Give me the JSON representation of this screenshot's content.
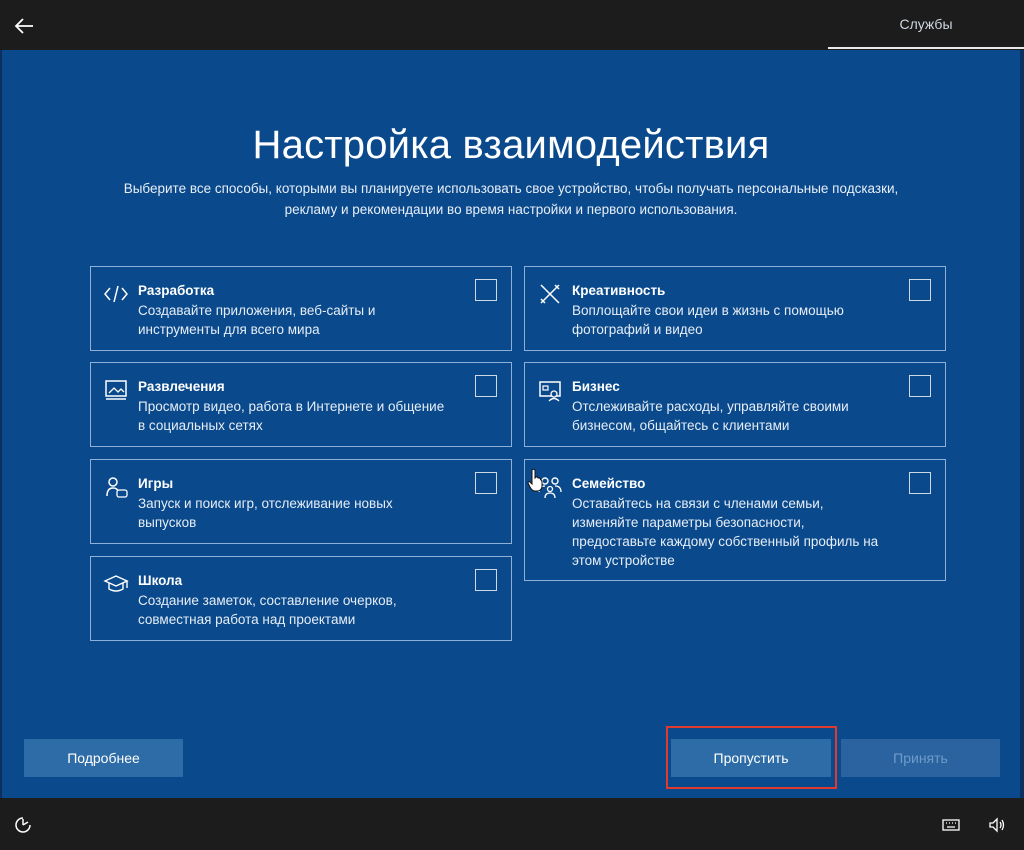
{
  "header": {
    "back_icon": "arrow-left-icon",
    "tab_label": "Службы"
  },
  "page": {
    "title": "Настройка взаимодействия",
    "subtitle_line1": "Выберите все способы, которыми вы планируете использовать свое устройство, чтобы получать персональные подсказки,",
    "subtitle_line2": "рекламу и рекомендации во время настройки и первого использования."
  },
  "options": [
    {
      "title": "Разработка",
      "desc1": "Создавайте приложения, веб-сайты и",
      "desc2": "инструменты для всего мира",
      "icon": "code-icon",
      "checked": false
    },
    {
      "title": "Креативность",
      "desc1": "Воплощайте свои идеи в жизнь с помощью",
      "desc2": "фотографий и видео",
      "icon": "pen-ruler-icon",
      "checked": false
    },
    {
      "title": "Развлечения",
      "desc1": "Просмотр видео, работа в Интернете и общение",
      "desc2": "в социальных сетях",
      "icon": "media-icon",
      "checked": false
    },
    {
      "title": "Бизнес",
      "desc1": "Отслеживайте расходы, управляйте своими",
      "desc2": "бизнесом, общайтесь с клиентами",
      "icon": "business-icon",
      "checked": false
    },
    {
      "title": "Игры",
      "desc1": "Запуск и поиск игр, отслеживание новых",
      "desc2": "выпусков",
      "icon": "games-icon",
      "checked": false
    },
    {
      "title": "Семейство",
      "desc1": "Оставайтесь на связи с членами семьи,",
      "desc2": "изменяйте параметры безопасности,",
      "desc3": "предоставьте каждому собственный профиль на",
      "desc4": "этом устройстве",
      "icon": "family-icon",
      "checked": false
    },
    {
      "title": "Школа",
      "desc1": "Создание заметок, составление очерков,",
      "desc2": "совместная работа над проектами",
      "icon": "graduation-cap-icon",
      "checked": false
    }
  ],
  "buttons": {
    "more": "Подробнее",
    "skip": "Пропустить",
    "accept": "Принять"
  },
  "footer": {
    "left_icon": "accessibility-icon",
    "keyboard_icon": "keyboard-icon",
    "volume_icon": "volume-icon"
  },
  "colors": {
    "background": "#0a4a8c",
    "bar": "#1c1c1c",
    "highlight": "#e03a2f"
  }
}
